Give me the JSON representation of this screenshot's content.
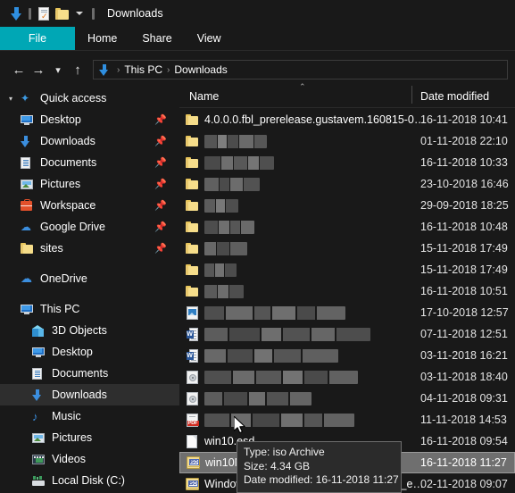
{
  "window": {
    "title": "Downloads",
    "quick_access_icons": [
      "download-arrow-icon",
      "properties-icon",
      "new-folder-icon",
      "customize-chevron-icon"
    ]
  },
  "ribbon": {
    "tabs": [
      {
        "label": "File",
        "active": true
      },
      {
        "label": "Home",
        "active": false
      },
      {
        "label": "Share",
        "active": false
      },
      {
        "label": "View",
        "active": false
      }
    ],
    "accent_color": "#00a7b5"
  },
  "navbar": {
    "back_icon": "arrow-left-icon",
    "forward_icon": "arrow-right-icon",
    "recent_icon": "chevron-down-icon",
    "up_icon": "arrow-up-icon",
    "breadcrumb": {
      "icon": "download-arrow-icon",
      "segments": [
        "This PC",
        "Downloads"
      ],
      "separator": "›"
    }
  },
  "sidebar": {
    "items": [
      {
        "label": "Quick access",
        "icon": "star-pin-icon",
        "indent": 0,
        "pinned": false,
        "selected": false,
        "expander": "⌄"
      },
      {
        "label": "Desktop",
        "icon": "monitor-icon",
        "indent": 1,
        "pinned": true,
        "selected": false
      },
      {
        "label": "Downloads",
        "icon": "download-arrow-icon",
        "indent": 1,
        "pinned": true,
        "selected": false
      },
      {
        "label": "Documents",
        "icon": "document-icon",
        "indent": 1,
        "pinned": true,
        "selected": false
      },
      {
        "label": "Pictures",
        "icon": "picture-icon",
        "indent": 1,
        "pinned": true,
        "selected": false
      },
      {
        "label": "Workspace",
        "icon": "briefcase-icon",
        "indent": 1,
        "pinned": true,
        "selected": false
      },
      {
        "label": "Google Drive",
        "icon": "cloud-icon",
        "indent": 1,
        "pinned": true,
        "selected": false
      },
      {
        "label": "sites",
        "icon": "folder-icon",
        "indent": 1,
        "pinned": true,
        "selected": false
      },
      {
        "label": "OneDrive",
        "icon": "onedrive-cloud-icon",
        "indent": 0,
        "pinned": false,
        "selected": false
      },
      {
        "label": "This PC",
        "icon": "this-pc-monitor-icon",
        "indent": 0,
        "pinned": false,
        "selected": false
      },
      {
        "label": "3D Objects",
        "icon": "cube-icon",
        "indent": 1,
        "pinned": false,
        "selected": false
      },
      {
        "label": "Desktop",
        "icon": "monitor-icon",
        "indent": 1,
        "pinned": false,
        "selected": false
      },
      {
        "label": "Documents",
        "icon": "document-icon",
        "indent": 1,
        "pinned": false,
        "selected": false
      },
      {
        "label": "Downloads",
        "icon": "download-arrow-icon",
        "indent": 1,
        "pinned": false,
        "selected": true
      },
      {
        "label": "Music",
        "icon": "music-note-icon",
        "indent": 1,
        "pinned": false,
        "selected": false
      },
      {
        "label": "Pictures",
        "icon": "picture-icon",
        "indent": 1,
        "pinned": false,
        "selected": false
      },
      {
        "label": "Videos",
        "icon": "video-icon",
        "indent": 1,
        "pinned": false,
        "selected": false
      },
      {
        "label": "Local Disk (C:)",
        "icon": "disk-drive-icon",
        "indent": 1,
        "pinned": false,
        "selected": false
      }
    ],
    "pin_glyph": "📌"
  },
  "filepane": {
    "columns": {
      "name": "Name",
      "date_modified": "Date modified"
    },
    "sort_indicator": "⌃",
    "rows": [
      {
        "name": "4.0.0.0.fbl_prerelease.gustavem.160815-0…",
        "date": "16-11-2018 10:41",
        "icon": "folder-icon",
        "redacted": false,
        "selected": false
      },
      {
        "name": "",
        "date": "01-11-2018 22:10",
        "icon": "folder-icon",
        "redacted": true,
        "blur_width": 70,
        "selected": false
      },
      {
        "name": "",
        "date": "16-11-2018 10:33",
        "icon": "folder-icon",
        "redacted": true,
        "blur_width": 78,
        "selected": false
      },
      {
        "name": "",
        "date": "23-10-2018 16:46",
        "icon": "folder-icon",
        "redacted": true,
        "blur_width": 62,
        "selected": false
      },
      {
        "name": "",
        "date": "29-09-2018 18:25",
        "icon": "folder-icon",
        "redacted": true,
        "blur_width": 38,
        "selected": false
      },
      {
        "name": "",
        "date": "16-11-2018 10:48",
        "icon": "folder-icon",
        "redacted": true,
        "blur_width": 56,
        "selected": false
      },
      {
        "name": "",
        "date": "15-11-2018 17:49",
        "icon": "folder-icon",
        "redacted": true,
        "blur_width": 48,
        "selected": false
      },
      {
        "name": "",
        "date": "15-11-2018 17:49",
        "icon": "folder-icon",
        "redacted": true,
        "blur_width": 36,
        "selected": false
      },
      {
        "name": "",
        "date": "16-11-2018 10:51",
        "icon": "folder-icon",
        "redacted": true,
        "blur_width": 44,
        "selected": false
      },
      {
        "name": "",
        "date": "17-10-2018 12:57",
        "icon": "image-file-icon",
        "redacted": true,
        "blur_width": 158,
        "selected": false
      },
      {
        "name": "",
        "date": "07-11-2018 12:51",
        "icon": "word-document-icon",
        "redacted": true,
        "blur_width": 186,
        "selected": false
      },
      {
        "name": "",
        "date": "03-11-2018 16:21",
        "icon": "word-document-icon",
        "redacted": true,
        "blur_width": 150,
        "selected": false
      },
      {
        "name": "",
        "date": "03-11-2018 18:40",
        "icon": "disc-image-icon",
        "redacted": true,
        "blur_width": 172,
        "selected": false
      },
      {
        "name": "",
        "date": "04-11-2018 09:31",
        "icon": "disc-image-icon",
        "redacted": true,
        "blur_width": 120,
        "selected": false
      },
      {
        "name": "",
        "date": "11-11-2018 14:53",
        "icon": "pdf-file-icon",
        "redacted": true,
        "blur_width": 168,
        "selected": false
      },
      {
        "name": "win10.esd",
        "date": "16-11-2018 09:54",
        "icon": "blank-file-icon",
        "redacted": false,
        "selected": false
      },
      {
        "name": "win10MTE.iso",
        "date": "16-11-2018 11:27",
        "icon": "iso-file-icon",
        "redacted": false,
        "selected": true
      },
      {
        "name": "Windows10_InsiderPreview_Client_x64_e…",
        "date": "02-11-2018 09:07",
        "icon": "iso-file-icon",
        "redacted": false,
        "selected": false
      }
    ]
  },
  "tooltip": {
    "type_line": "Type: iso Archive",
    "size_line": "Size: 4.34 GB",
    "date_line": "Date modified: 16-11-2018 11:27"
  },
  "cursor": {
    "icon": "mouse-pointer-icon"
  }
}
